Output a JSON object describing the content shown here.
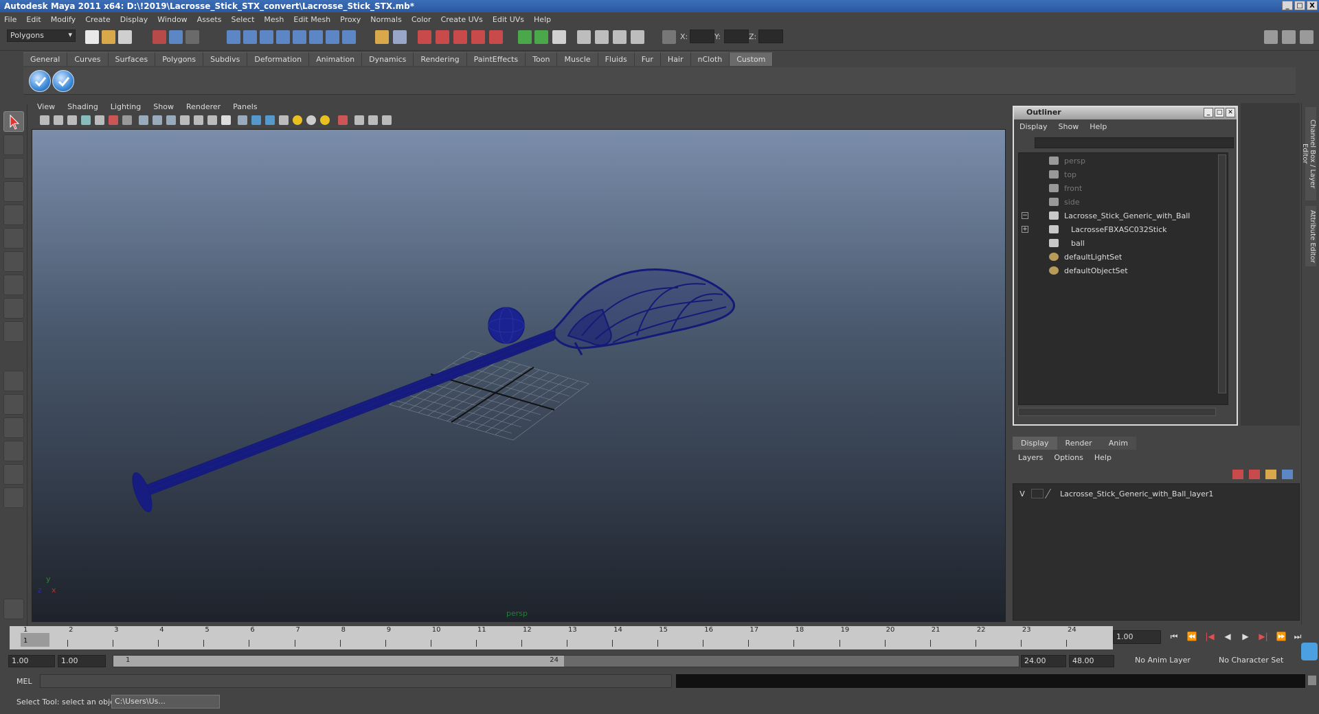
{
  "window": {
    "title": "Autodesk Maya 2011 x64: D:\\!2019\\Lacrosse_Stick_STX_convert\\Lacrosse_Stick_STX.mb*",
    "controls": [
      "_",
      "□",
      "X"
    ]
  },
  "menubar": [
    "File",
    "Edit",
    "Modify",
    "Create",
    "Display",
    "Window",
    "Assets",
    "Select",
    "Mesh",
    "Edit Mesh",
    "Proxy",
    "Normals",
    "Color",
    "Create UVs",
    "Edit UVs",
    "Help"
  ],
  "statusline": {
    "mode_select": "Polygons",
    "x_label": "X:",
    "y_label": "Y:",
    "z_label": "Z:"
  },
  "shelf": {
    "tabs": [
      "General",
      "Curves",
      "Surfaces",
      "Polygons",
      "Subdivs",
      "Deformation",
      "Animation",
      "Dynamics",
      "Rendering",
      "PaintEffects",
      "Toon",
      "Muscle",
      "Fluids",
      "Fur",
      "Hair",
      "nCloth",
      "Custom"
    ],
    "active_tab": "Custom"
  },
  "viewport": {
    "menu": [
      "View",
      "Shading",
      "Lighting",
      "Show",
      "Renderer",
      "Panels"
    ],
    "camera_label": "persp",
    "axis_x": "x",
    "axis_y": "y",
    "axis_z": "z",
    "wire_color": "#141a78"
  },
  "outliner": {
    "title": "Outliner",
    "menu": [
      "Display",
      "Show",
      "Help"
    ],
    "items": [
      {
        "label": "persp",
        "dim": true
      },
      {
        "label": "top",
        "dim": true
      },
      {
        "label": "front",
        "dim": true
      },
      {
        "label": "side",
        "dim": true
      },
      {
        "label": "Lacrosse_Stick_Generic_with_Ball",
        "dim": false
      },
      {
        "label": "LacrosseFBXASC032Stick",
        "dim": false
      },
      {
        "label": "ball",
        "dim": false
      },
      {
        "label": "defaultLightSet",
        "dim": false
      },
      {
        "label": "defaultObjectSet",
        "dim": false
      }
    ]
  },
  "side_tabs": [
    "Channel Box / Layer Editor",
    "Attribute Editor"
  ],
  "layer_editor": {
    "tabs": [
      "Display",
      "Render",
      "Anim"
    ],
    "active_tab": "Display",
    "menu": [
      "Layers",
      "Options",
      "Help"
    ],
    "layer": {
      "visibility": "V",
      "name": "Lacrosse_Stick_Generic_with_Ball_layer1"
    }
  },
  "timeline": {
    "ticks": [
      "1",
      "2",
      "3",
      "4",
      "5",
      "6",
      "7",
      "8",
      "9",
      "10",
      "11",
      "12",
      "13",
      "14",
      "15",
      "16",
      "17",
      "18",
      "19",
      "20",
      "21",
      "22",
      "23",
      "24"
    ],
    "current_frame_marker": "1",
    "current_time": "1.00"
  },
  "range": {
    "start_time": "1.00",
    "playback_start": "1.00",
    "slider_start": "1",
    "slider_end": "24",
    "playback_end": "24.00",
    "end_time": "48.00",
    "anim_layer": "No Anim Layer",
    "character_set": "No Character Set"
  },
  "command": {
    "label": "MEL"
  },
  "help": {
    "text": "Select Tool: select an object",
    "task": "C:\\Users\\Us..."
  }
}
